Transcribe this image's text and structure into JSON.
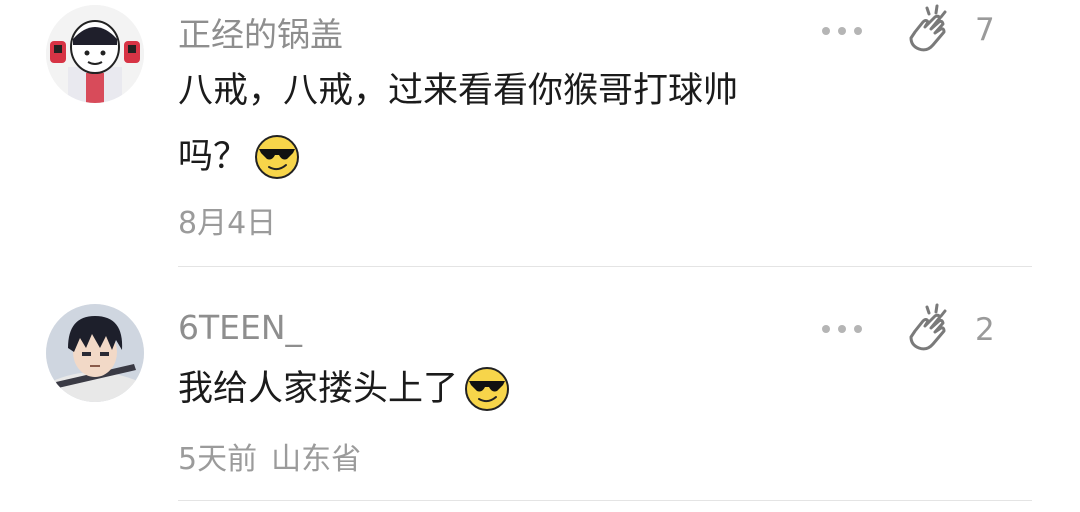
{
  "comments": [
    {
      "username": "正经的锅盖",
      "likes": "7",
      "text_lines": [
        "八戒，八戒，过来看看你猴哥打球帅",
        "吗？"
      ],
      "date": "8月4日",
      "location": "",
      "avatar_icon": "helmet-mask-avatar",
      "emoji_icon": "sunglasses-emoji"
    },
    {
      "username": "6TEEN_",
      "likes": "2",
      "text_lines": [
        "我给人家搂头上了"
      ],
      "date": "5天前",
      "location": "山东省",
      "avatar_icon": "anime-boy-avatar",
      "emoji_icon": "sunglasses-emoji"
    }
  ],
  "colors": {
    "username": "#8e8e8e",
    "text": "#1b1b1b",
    "meta": "#9b9b9b",
    "divider": "#e4e4e4",
    "emoji_face": "#f7d54a"
  }
}
